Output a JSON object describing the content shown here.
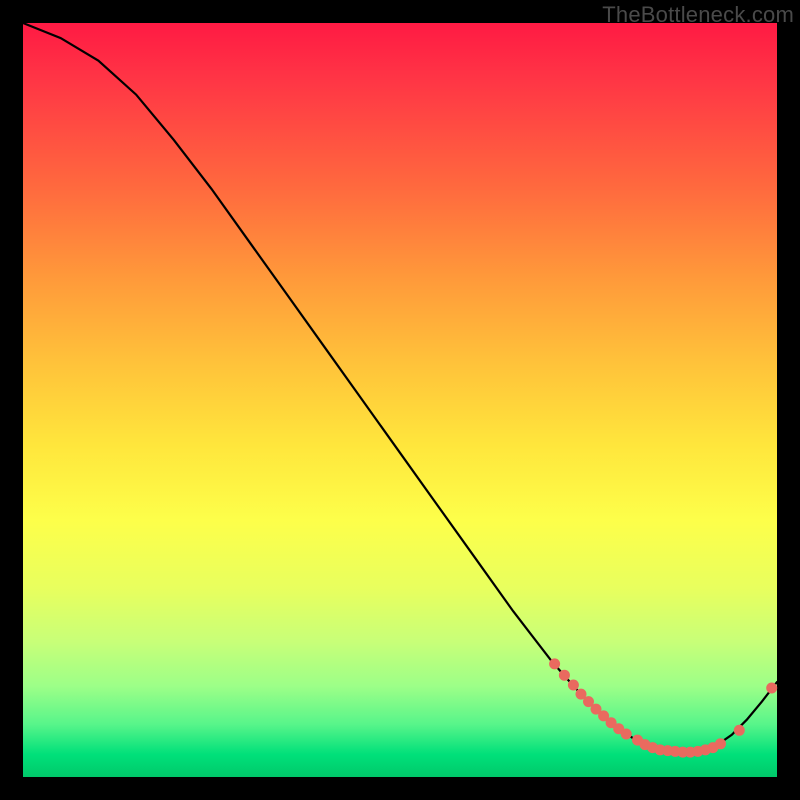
{
  "watermark": "TheBottleneck.com",
  "chart_data": {
    "type": "line",
    "title": "",
    "xlabel": "",
    "ylabel": "",
    "xlim": [
      0,
      100
    ],
    "ylim": [
      0,
      100
    ],
    "series": [
      {
        "name": "curve",
        "color": "#000000",
        "x": [
          0,
          5,
          10,
          15,
          20,
          25,
          30,
          35,
          40,
          45,
          50,
          55,
          60,
          65,
          70,
          72,
          74,
          76,
          78,
          80,
          82,
          84,
          86,
          88,
          90,
          92,
          94,
          96,
          98,
          100
        ],
        "values": [
          100,
          98,
          95,
          90.5,
          84.5,
          78,
          71,
          64,
          57,
          50,
          43,
          36,
          29,
          22,
          15.5,
          13.2,
          11,
          9,
          7.2,
          5.7,
          4.5,
          3.8,
          3.4,
          3.3,
          3.5,
          4.2,
          5.6,
          7.6,
          10,
          12.6
        ]
      }
    ],
    "markers": [
      {
        "name": "dots",
        "color": "#e96a5f",
        "points": [
          {
            "x": 70.5,
            "y": 15.0
          },
          {
            "x": 71.8,
            "y": 13.5
          },
          {
            "x": 73.0,
            "y": 12.2
          },
          {
            "x": 74.0,
            "y": 11.0
          },
          {
            "x": 75.0,
            "y": 10.0
          },
          {
            "x": 76.0,
            "y": 9.0
          },
          {
            "x": 77.0,
            "y": 8.1
          },
          {
            "x": 78.0,
            "y": 7.2
          },
          {
            "x": 79.0,
            "y": 6.4
          },
          {
            "x": 80.0,
            "y": 5.7
          },
          {
            "x": 81.5,
            "y": 4.9
          },
          {
            "x": 82.5,
            "y": 4.3
          },
          {
            "x": 83.5,
            "y": 3.9
          },
          {
            "x": 84.5,
            "y": 3.6
          },
          {
            "x": 85.5,
            "y": 3.5
          },
          {
            "x": 86.5,
            "y": 3.4
          },
          {
            "x": 87.5,
            "y": 3.3
          },
          {
            "x": 88.5,
            "y": 3.3
          },
          {
            "x": 89.5,
            "y": 3.4
          },
          {
            "x": 90.5,
            "y": 3.6
          },
          {
            "x": 91.5,
            "y": 3.9
          },
          {
            "x": 92.5,
            "y": 4.4
          },
          {
            "x": 95.0,
            "y": 6.2
          },
          {
            "x": 99.3,
            "y": 11.8
          }
        ]
      }
    ]
  }
}
